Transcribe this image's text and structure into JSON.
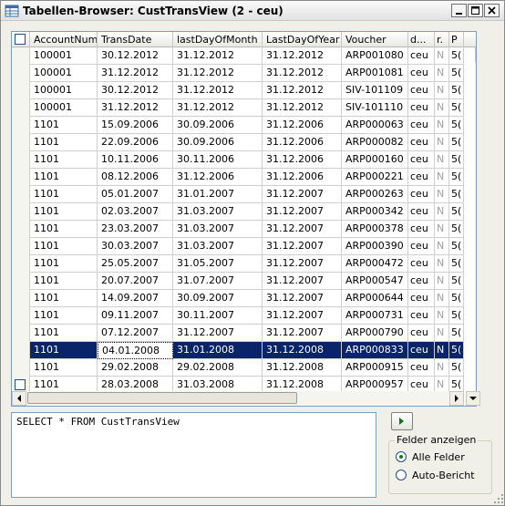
{
  "window": {
    "title": "Tabellen-Browser: CustTransView (2 - ceu)"
  },
  "grid": {
    "columns": [
      "AccountNum",
      "TransDate",
      "lastDayOfMonth",
      "LastDayOfYear",
      "Voucher",
      "d...",
      "r.",
      "P"
    ],
    "rows": [
      [
        "100001",
        "30.12.2012",
        "31.12.2012",
        "31.12.2012",
        "ARP001080",
        "ceu",
        "N",
        "5("
      ],
      [
        "100001",
        "31.12.2012",
        "31.12.2012",
        "31.12.2012",
        "ARP001081",
        "ceu",
        "N",
        "5("
      ],
      [
        "100001",
        "30.12.2012",
        "31.12.2012",
        "31.12.2012",
        "SIV-101109",
        "ceu",
        "N",
        "5("
      ],
      [
        "100001",
        "31.12.2012",
        "31.12.2012",
        "31.12.2012",
        "SIV-101110",
        "ceu",
        "N",
        "5("
      ],
      [
        "1101",
        "15.09.2006",
        "30.09.2006",
        "31.12.2006",
        "ARP000063",
        "ceu",
        "N",
        "5("
      ],
      [
        "1101",
        "22.09.2006",
        "30.09.2006",
        "31.12.2006",
        "ARP000082",
        "ceu",
        "N",
        "5("
      ],
      [
        "1101",
        "10.11.2006",
        "30.11.2006",
        "31.12.2006",
        "ARP000160",
        "ceu",
        "N",
        "5("
      ],
      [
        "1101",
        "08.12.2006",
        "31.12.2006",
        "31.12.2006",
        "ARP000221",
        "ceu",
        "N",
        "5("
      ],
      [
        "1101",
        "05.01.2007",
        "31.01.2007",
        "31.12.2007",
        "ARP000263",
        "ceu",
        "N",
        "5("
      ],
      [
        "1101",
        "02.03.2007",
        "31.03.2007",
        "31.12.2007",
        "ARP000342",
        "ceu",
        "N",
        "5("
      ],
      [
        "1101",
        "23.03.2007",
        "31.03.2007",
        "31.12.2007",
        "ARP000378",
        "ceu",
        "N",
        "5("
      ],
      [
        "1101",
        "30.03.2007",
        "31.03.2007",
        "31.12.2007",
        "ARP000390",
        "ceu",
        "N",
        "5("
      ],
      [
        "1101",
        "25.05.2007",
        "31.05.2007",
        "31.12.2007",
        "ARP000472",
        "ceu",
        "N",
        "5("
      ],
      [
        "1101",
        "20.07.2007",
        "31.07.2007",
        "31.12.2007",
        "ARP000547",
        "ceu",
        "N",
        "5("
      ],
      [
        "1101",
        "14.09.2007",
        "30.09.2007",
        "31.12.2007",
        "ARP000644",
        "ceu",
        "N",
        "5("
      ],
      [
        "1101",
        "09.11.2007",
        "30.11.2007",
        "31.12.2007",
        "ARP000731",
        "ceu",
        "N",
        "5("
      ],
      [
        "1101",
        "07.12.2007",
        "31.12.2007",
        "31.12.2007",
        "ARP000790",
        "ceu",
        "N",
        "5("
      ],
      [
        "1101",
        "04.01.2008",
        "31.01.2008",
        "31.12.2008",
        "ARP000833",
        "ceu",
        "N",
        "5("
      ],
      [
        "1101",
        "29.02.2008",
        "29.02.2008",
        "31.12.2008",
        "ARP000915",
        "ceu",
        "N",
        "5("
      ],
      [
        "1101",
        "28.03.2008",
        "31.03.2008",
        "31.12.2008",
        "ARP000957",
        "ceu",
        "N",
        "5("
      ]
    ],
    "selected_row": 17,
    "checked_rows": []
  },
  "sql": {
    "text": "SELECT * FROM CustTransView"
  },
  "fields_group": {
    "title": "Felder anzeigen",
    "options": [
      "Alle Felder",
      "Auto-Bericht"
    ],
    "selected": "Alle Felder"
  },
  "icons": [
    "app-icon",
    "minimize-icon",
    "maximize-icon",
    "close-icon",
    "run-arrow-icon",
    "scroll-up-icon",
    "scroll-down-icon",
    "scroll-left-icon",
    "scroll-right-icon",
    "size-grip-icon"
  ],
  "colors": {
    "selection": "#0a246a",
    "radio_dot": "#1a7a1a",
    "border": "#7f9db9"
  }
}
